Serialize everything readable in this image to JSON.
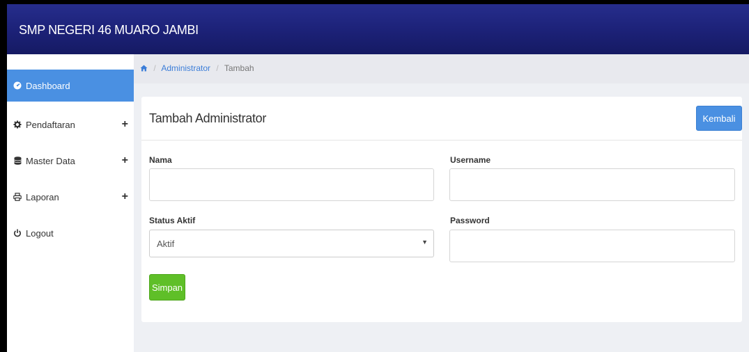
{
  "app": {
    "title": "SMP NEGERI 46 MUARO JAMBI"
  },
  "sidebar": {
    "items": [
      {
        "label": "Dashboard",
        "icon": "dashboard-icon",
        "active": true
      },
      {
        "label": "Pendaftaran",
        "icon": "gear-icon",
        "expandable": true
      },
      {
        "label": "Master Data",
        "icon": "database-icon",
        "expandable": true
      },
      {
        "label": "Laporan",
        "icon": "print-icon",
        "expandable": true
      },
      {
        "label": "Logout",
        "icon": "power-icon"
      }
    ]
  },
  "breadcrumb": {
    "home_icon": "home-icon",
    "level1": "Administrator",
    "level2": "Tambah"
  },
  "panel": {
    "title": "Tambah Administrator",
    "back_button": "Kembali",
    "fields": {
      "nama": {
        "label": "Nama",
        "value": ""
      },
      "username": {
        "label": "Username",
        "value": ""
      },
      "status": {
        "label": "Status Aktif",
        "value": "Aktif"
      },
      "password": {
        "label": "Password",
        "value": ""
      }
    },
    "save_button": "Simpan"
  },
  "colors": {
    "topbar": "#1c2177",
    "accent": "#4a90e2",
    "success": "#5fbf28",
    "content_bg": "#eef0f4"
  }
}
